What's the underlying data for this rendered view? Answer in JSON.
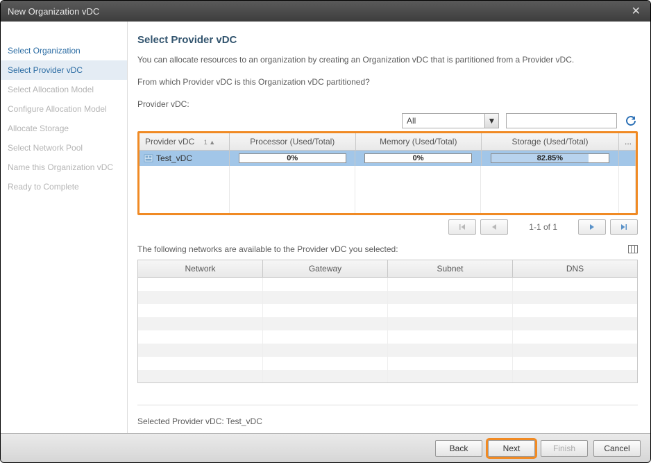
{
  "titlebar": {
    "title": "New Organization vDC"
  },
  "sidebar": {
    "items": [
      {
        "label": "Select Organization",
        "state": "enabled"
      },
      {
        "label": "Select Provider vDC",
        "state": "active"
      },
      {
        "label": "Select Allocation Model",
        "state": "disabled"
      },
      {
        "label": "Configure Allocation Model",
        "state": "disabled"
      },
      {
        "label": "Allocate Storage",
        "state": "disabled"
      },
      {
        "label": "Select Network Pool",
        "state": "disabled"
      },
      {
        "label": "Name this Organization vDC",
        "state": "disabled"
      },
      {
        "label": "Ready to Complete",
        "state": "disabled"
      }
    ]
  },
  "main": {
    "heading": "Select Provider vDC",
    "description": "You can allocate resources to an organization by creating an Organization vDC that is partitioned from a Provider vDC.",
    "question": "From which Provider vDC is this Organization vDC partitioned?",
    "label_provider": "Provider vDC:",
    "filter": {
      "dropdown_value": "All",
      "search_placeholder": ""
    },
    "provider_table": {
      "columns": {
        "pvdc": "Provider vDC",
        "sort": "1 ▲",
        "proc": "Processor (Used/Total)",
        "mem": "Memory (Used/Total)",
        "stor": "Storage (Used/Total)",
        "more": "..."
      },
      "rows": [
        {
          "name": "Test_vDC",
          "proc": "0%",
          "proc_fill": 0,
          "mem": "0%",
          "mem_fill": 0,
          "stor": "82.85%",
          "stor_fill": 82.85
        }
      ]
    },
    "pager": {
      "text": "1-1 of 1"
    },
    "networks_label": "The following networks are available to the Provider vDC you selected:",
    "network_table": {
      "columns": {
        "net": "Network",
        "gw": "Gateway",
        "sub": "Subnet",
        "dns": "DNS"
      }
    },
    "selected_label": "Selected Provider vDC:",
    "selected_value": "Test_vDC"
  },
  "footer": {
    "back": "Back",
    "next": "Next",
    "finish": "Finish",
    "cancel": "Cancel"
  }
}
